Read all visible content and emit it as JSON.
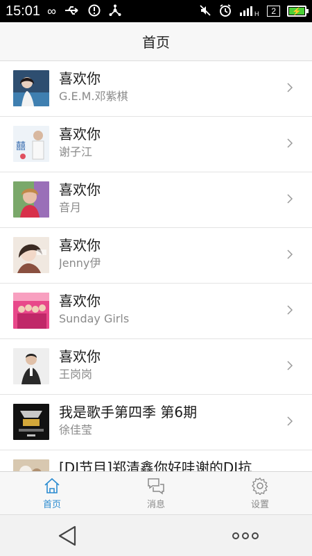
{
  "status_bar": {
    "time": "15:01",
    "sim_indicator": "2",
    "network": "H"
  },
  "header": {
    "title": "首页"
  },
  "songs": [
    {
      "title": "喜欢你",
      "artist": "G.E.M.邓紫棋",
      "thumb_color": "#6a8fb3"
    },
    {
      "title": "喜欢你",
      "artist": "谢子江",
      "thumb_color": "#dfe9f2"
    },
    {
      "title": "喜欢你",
      "artist": "音月",
      "thumb_color": "#b97a6a"
    },
    {
      "title": "喜欢你",
      "artist": "Jenny伊",
      "thumb_color": "#d9c7b6"
    },
    {
      "title": "喜欢你",
      "artist": "Sunday Girls",
      "thumb_color": "#d2508a"
    },
    {
      "title": "喜欢你",
      "artist": "王岗岗",
      "thumb_color": "#e8e8e8"
    },
    {
      "title": "我是歌手第四季 第6期",
      "artist": "徐佳莹",
      "thumb_color": "#1a1a1a"
    },
    {
      "title": "[DJ节目]郑清鑫你好哇谢的DJ抗",
      "artist": "",
      "thumb_color": "#c8b49a"
    }
  ],
  "tabs": [
    {
      "label": "首页",
      "icon": "home-icon",
      "active": true
    },
    {
      "label": "消息",
      "icon": "message-icon",
      "active": false
    },
    {
      "label": "设置",
      "icon": "settings-icon",
      "active": false
    }
  ],
  "colors": {
    "accent": "#2a8bd0",
    "inactive": "#8a8a8a"
  }
}
